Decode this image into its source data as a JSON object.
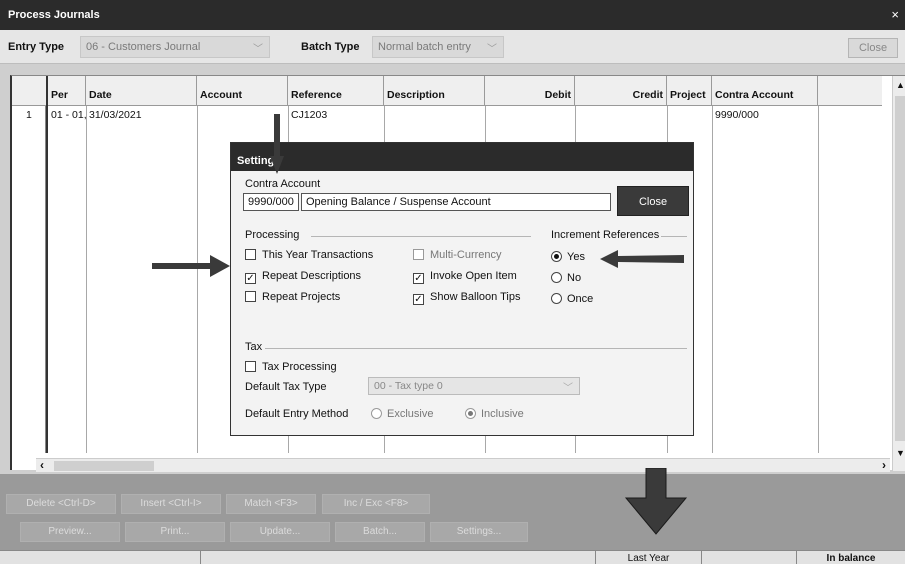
{
  "window": {
    "title": "Process Journals",
    "close_glyph": "×"
  },
  "filters": {
    "entry_type_label": "Entry Type",
    "entry_type_value": "06 - Customers Journal",
    "batch_type_label": "Batch Type",
    "batch_type_value": "Normal batch entry",
    "close_label": "Close"
  },
  "grid": {
    "columns": [
      "Per",
      "Date",
      "Account",
      "Reference",
      "Description",
      "Debit",
      "Credit",
      "Project",
      "Contra Account"
    ],
    "rows": [
      {
        "num": "1",
        "per": "01 - 01,",
        "date": "31/03/2021",
        "account": "",
        "reference": "CJ1203",
        "description": "",
        "debit": "",
        "credit": "",
        "project": "",
        "contra": "9990/000"
      }
    ]
  },
  "actions": {
    "delete": "Delete <Ctrl-D>",
    "insert": "Insert <Ctrl-I>",
    "match": "Match <F3>",
    "incexc": "Inc / Exc <F8>",
    "preview": "Preview...",
    "print": "Print...",
    "update": "Update...",
    "batch": "Batch...",
    "settings": "Settings..."
  },
  "status": {
    "last_year": "Last Year",
    "balance": "In balance"
  },
  "settings_dialog": {
    "title": "Setting",
    "contra_label": "Contra Account",
    "contra_code": "9990/000",
    "contra_desc": "Opening Balance / Suspense Account",
    "close_label": "Close",
    "processing_label": "Processing",
    "this_year": "This Year Transactions",
    "repeat_desc": "Repeat Descriptions",
    "repeat_proj": "Repeat Projects",
    "multi_currency": "Multi-Currency",
    "invoke_open": "Invoke Open Item",
    "balloon_tips": "Show Balloon Tips",
    "increment_label": "Increment References",
    "inc_yes": "Yes",
    "inc_no": "No",
    "inc_once": "Once",
    "tax_label": "Tax",
    "tax_processing": "Tax Processing",
    "default_tax_label": "Default Tax Type",
    "default_tax_value": "00 - Tax type 0",
    "default_entry_label": "Default Entry Method",
    "exclusive": "Exclusive",
    "inclusive": "Inclusive",
    "checked": {
      "this_year": false,
      "repeat_desc": true,
      "repeat_proj": false,
      "multi_currency": false,
      "invoke_open": true,
      "balloon_tips": true,
      "tax_processing": false
    },
    "increment_selected": "Yes",
    "entry_selected": "Inclusive"
  },
  "colors": {
    "titlebar": "#2b2b2b",
    "annotation_arrow": "#3a3a3a"
  }
}
